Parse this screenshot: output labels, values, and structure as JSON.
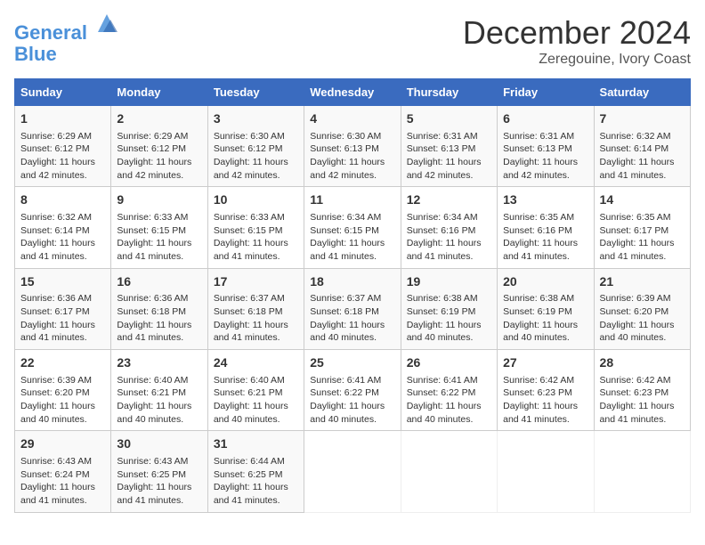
{
  "header": {
    "logo_line1": "General",
    "logo_line2": "Blue",
    "month": "December 2024",
    "location": "Zeregouine, Ivory Coast"
  },
  "weekdays": [
    "Sunday",
    "Monday",
    "Tuesday",
    "Wednesday",
    "Thursday",
    "Friday",
    "Saturday"
  ],
  "weeks": [
    [
      {
        "day": "1",
        "lines": [
          "Sunrise: 6:29 AM",
          "Sunset: 6:12 PM",
          "Daylight: 11 hours",
          "and 42 minutes."
        ]
      },
      {
        "day": "2",
        "lines": [
          "Sunrise: 6:29 AM",
          "Sunset: 6:12 PM",
          "Daylight: 11 hours",
          "and 42 minutes."
        ]
      },
      {
        "day": "3",
        "lines": [
          "Sunrise: 6:30 AM",
          "Sunset: 6:12 PM",
          "Daylight: 11 hours",
          "and 42 minutes."
        ]
      },
      {
        "day": "4",
        "lines": [
          "Sunrise: 6:30 AM",
          "Sunset: 6:13 PM",
          "Daylight: 11 hours",
          "and 42 minutes."
        ]
      },
      {
        "day": "5",
        "lines": [
          "Sunrise: 6:31 AM",
          "Sunset: 6:13 PM",
          "Daylight: 11 hours",
          "and 42 minutes."
        ]
      },
      {
        "day": "6",
        "lines": [
          "Sunrise: 6:31 AM",
          "Sunset: 6:13 PM",
          "Daylight: 11 hours",
          "and 42 minutes."
        ]
      },
      {
        "day": "7",
        "lines": [
          "Sunrise: 6:32 AM",
          "Sunset: 6:14 PM",
          "Daylight: 11 hours",
          "and 41 minutes."
        ]
      }
    ],
    [
      {
        "day": "8",
        "lines": [
          "Sunrise: 6:32 AM",
          "Sunset: 6:14 PM",
          "Daylight: 11 hours",
          "and 41 minutes."
        ]
      },
      {
        "day": "9",
        "lines": [
          "Sunrise: 6:33 AM",
          "Sunset: 6:15 PM",
          "Daylight: 11 hours",
          "and 41 minutes."
        ]
      },
      {
        "day": "10",
        "lines": [
          "Sunrise: 6:33 AM",
          "Sunset: 6:15 PM",
          "Daylight: 11 hours",
          "and 41 minutes."
        ]
      },
      {
        "day": "11",
        "lines": [
          "Sunrise: 6:34 AM",
          "Sunset: 6:15 PM",
          "Daylight: 11 hours",
          "and 41 minutes."
        ]
      },
      {
        "day": "12",
        "lines": [
          "Sunrise: 6:34 AM",
          "Sunset: 6:16 PM",
          "Daylight: 11 hours",
          "and 41 minutes."
        ]
      },
      {
        "day": "13",
        "lines": [
          "Sunrise: 6:35 AM",
          "Sunset: 6:16 PM",
          "Daylight: 11 hours",
          "and 41 minutes."
        ]
      },
      {
        "day": "14",
        "lines": [
          "Sunrise: 6:35 AM",
          "Sunset: 6:17 PM",
          "Daylight: 11 hours",
          "and 41 minutes."
        ]
      }
    ],
    [
      {
        "day": "15",
        "lines": [
          "Sunrise: 6:36 AM",
          "Sunset: 6:17 PM",
          "Daylight: 11 hours",
          "and 41 minutes."
        ]
      },
      {
        "day": "16",
        "lines": [
          "Sunrise: 6:36 AM",
          "Sunset: 6:18 PM",
          "Daylight: 11 hours",
          "and 41 minutes."
        ]
      },
      {
        "day": "17",
        "lines": [
          "Sunrise: 6:37 AM",
          "Sunset: 6:18 PM",
          "Daylight: 11 hours",
          "and 41 minutes."
        ]
      },
      {
        "day": "18",
        "lines": [
          "Sunrise: 6:37 AM",
          "Sunset: 6:18 PM",
          "Daylight: 11 hours",
          "and 40 minutes."
        ]
      },
      {
        "day": "19",
        "lines": [
          "Sunrise: 6:38 AM",
          "Sunset: 6:19 PM",
          "Daylight: 11 hours",
          "and 40 minutes."
        ]
      },
      {
        "day": "20",
        "lines": [
          "Sunrise: 6:38 AM",
          "Sunset: 6:19 PM",
          "Daylight: 11 hours",
          "and 40 minutes."
        ]
      },
      {
        "day": "21",
        "lines": [
          "Sunrise: 6:39 AM",
          "Sunset: 6:20 PM",
          "Daylight: 11 hours",
          "and 40 minutes."
        ]
      }
    ],
    [
      {
        "day": "22",
        "lines": [
          "Sunrise: 6:39 AM",
          "Sunset: 6:20 PM",
          "Daylight: 11 hours",
          "and 40 minutes."
        ]
      },
      {
        "day": "23",
        "lines": [
          "Sunrise: 6:40 AM",
          "Sunset: 6:21 PM",
          "Daylight: 11 hours",
          "and 40 minutes."
        ]
      },
      {
        "day": "24",
        "lines": [
          "Sunrise: 6:40 AM",
          "Sunset: 6:21 PM",
          "Daylight: 11 hours",
          "and 40 minutes."
        ]
      },
      {
        "day": "25",
        "lines": [
          "Sunrise: 6:41 AM",
          "Sunset: 6:22 PM",
          "Daylight: 11 hours",
          "and 40 minutes."
        ]
      },
      {
        "day": "26",
        "lines": [
          "Sunrise: 6:41 AM",
          "Sunset: 6:22 PM",
          "Daylight: 11 hours",
          "and 40 minutes."
        ]
      },
      {
        "day": "27",
        "lines": [
          "Sunrise: 6:42 AM",
          "Sunset: 6:23 PM",
          "Daylight: 11 hours",
          "and 41 minutes."
        ]
      },
      {
        "day": "28",
        "lines": [
          "Sunrise: 6:42 AM",
          "Sunset: 6:23 PM",
          "Daylight: 11 hours",
          "and 41 minutes."
        ]
      }
    ],
    [
      {
        "day": "29",
        "lines": [
          "Sunrise: 6:43 AM",
          "Sunset: 6:24 PM",
          "Daylight: 11 hours",
          "and 41 minutes."
        ]
      },
      {
        "day": "30",
        "lines": [
          "Sunrise: 6:43 AM",
          "Sunset: 6:25 PM",
          "Daylight: 11 hours",
          "and 41 minutes."
        ]
      },
      {
        "day": "31",
        "lines": [
          "Sunrise: 6:44 AM",
          "Sunset: 6:25 PM",
          "Daylight: 11 hours",
          "and 41 minutes."
        ]
      },
      null,
      null,
      null,
      null
    ]
  ]
}
